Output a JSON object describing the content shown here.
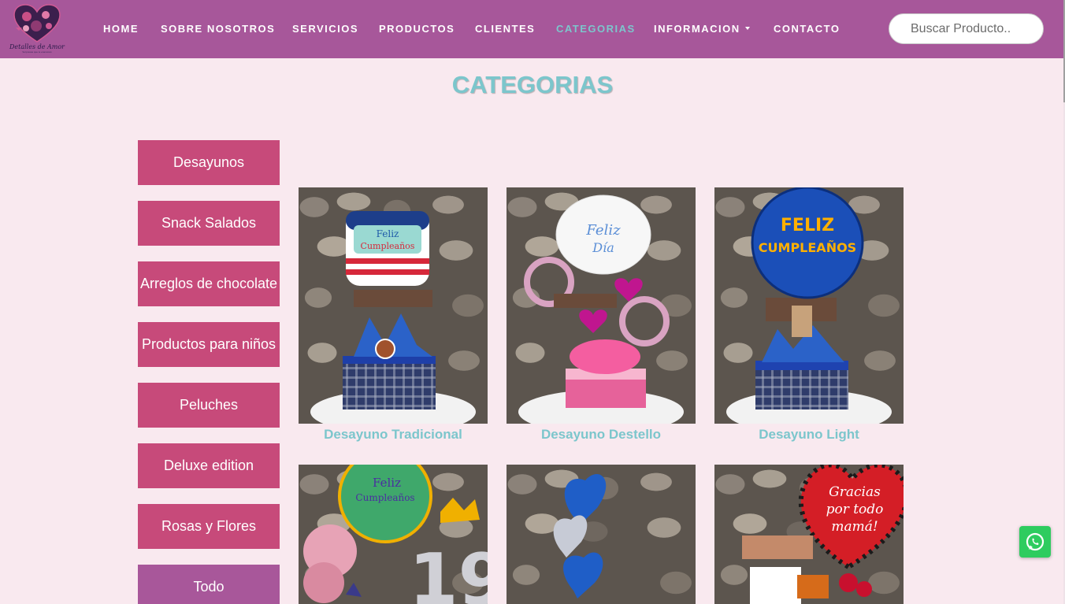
{
  "brand": {
    "name": "Detalles de Amor",
    "tagline": "Sorpresas que te enamoran"
  },
  "nav": {
    "items": [
      {
        "label": "HOME"
      },
      {
        "label": "SOBRE NOSOTROS"
      },
      {
        "label": "SERVICIOS"
      },
      {
        "label": "PRODUCTOS"
      },
      {
        "label": "CLIENTES"
      },
      {
        "label": "CATEGORIAS",
        "active": true
      },
      {
        "label": "INFORMACION",
        "dropdown": true
      },
      {
        "label": "CONTACTO"
      }
    ],
    "search_placeholder": "Buscar Producto.."
  },
  "page": {
    "title": "CATEGORIAS"
  },
  "sidebar": {
    "categories": [
      {
        "label": "Desayunos"
      },
      {
        "label": "Snack Salados"
      },
      {
        "label": "Arreglos de chocolate"
      },
      {
        "label": "Productos para niños"
      },
      {
        "label": "Peluches"
      },
      {
        "label": "Deluxe edition"
      },
      {
        "label": "Rosas y Flores"
      },
      {
        "label": "Todo"
      }
    ]
  },
  "products": [
    {
      "name": "Desayuno Tradicional",
      "balloon_text": "Feliz Cumpleaños"
    },
    {
      "name": "Desayuno Destello",
      "balloon_text": "Feliz Día"
    },
    {
      "name": "Desayuno Light",
      "balloon_text": "FELIZ CUMPLEAÑOS"
    },
    {
      "name": "",
      "balloon_text": "Feliz Cumpleaños"
    },
    {
      "name": "",
      "balloon_text": ""
    },
    {
      "name": "",
      "balloon_text": "Gracias por todo mamá!"
    }
  ],
  "colors": {
    "navbar": "#a7579a",
    "accent_teal": "#7cc6cc",
    "category_button": "#c74a7a",
    "todo_button": "#a8579a",
    "background": "#f9e9ef",
    "whatsapp": "#2ecc5f"
  },
  "icons": {
    "logo": "heart-logo-icon",
    "dropdown": "caret-down-icon",
    "whatsapp": "whatsapp-icon"
  }
}
